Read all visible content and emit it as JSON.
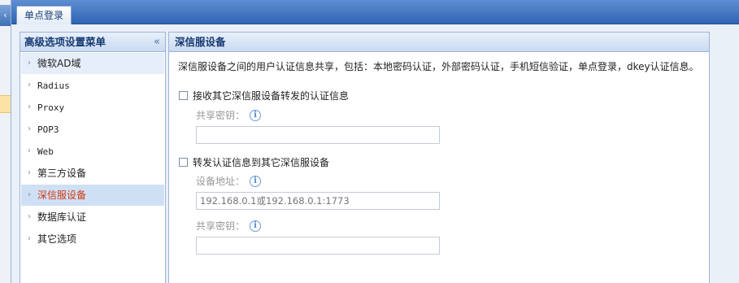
{
  "edge": {
    "collapse_glyph": "‹"
  },
  "tabbar": {
    "tab_label": "单点登录"
  },
  "sidebar": {
    "title": "高级选项设置菜单",
    "collapse_glyph": "«",
    "items": [
      {
        "label": "微软AD域",
        "state": "hover"
      },
      {
        "label": "Radius",
        "state": "normal"
      },
      {
        "label": "Proxy",
        "state": "normal"
      },
      {
        "label": "POP3",
        "state": "normal"
      },
      {
        "label": "Web",
        "state": "normal"
      },
      {
        "label": "第三方设备",
        "state": "normal"
      },
      {
        "label": "深信服设备",
        "state": "active"
      },
      {
        "label": "数据库认证",
        "state": "normal"
      },
      {
        "label": "其它选项",
        "state": "normal"
      }
    ]
  },
  "panel": {
    "title": "深信服设备",
    "description": "深信服设备之间的用户认证信息共享，包括：本地密码认证，外部密码认证，手机短信验证，单点登录，dkey认证信息。",
    "receive": {
      "checkbox_label": "接收其它深信服设备转发的认证信息",
      "checked": false,
      "key_label": "共享密钥：",
      "key_value": ""
    },
    "forward": {
      "checkbox_label": "转发认证信息到其它深信服设备",
      "checked": false,
      "address_label": "设备地址：",
      "address_placeholder": "192.168.0.1或192.168.0.1:1773",
      "key_label": "共享密钥：",
      "key_value": ""
    },
    "info_glyph": "i"
  },
  "colors": {
    "tabbar": "#2f64b3",
    "active_item_text": "#d3380f",
    "header_bg": "#c9daf1"
  }
}
